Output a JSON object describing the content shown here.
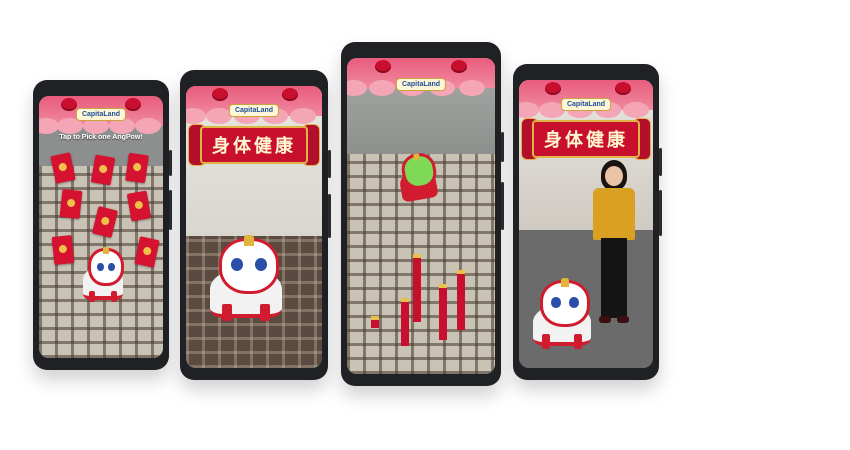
{
  "brand": {
    "logo_text": "CapitaLand",
    "colors": {
      "canopy": "#e85b7c",
      "lantern": "#c8102e",
      "banner": "#c8102e",
      "envelope": "#d5122f"
    }
  },
  "screens": [
    {
      "hint": "Tap to Pick one AngPow!"
    },
    {
      "banner": "身体健康"
    },
    {},
    {
      "banner": "身体健康"
    }
  ]
}
